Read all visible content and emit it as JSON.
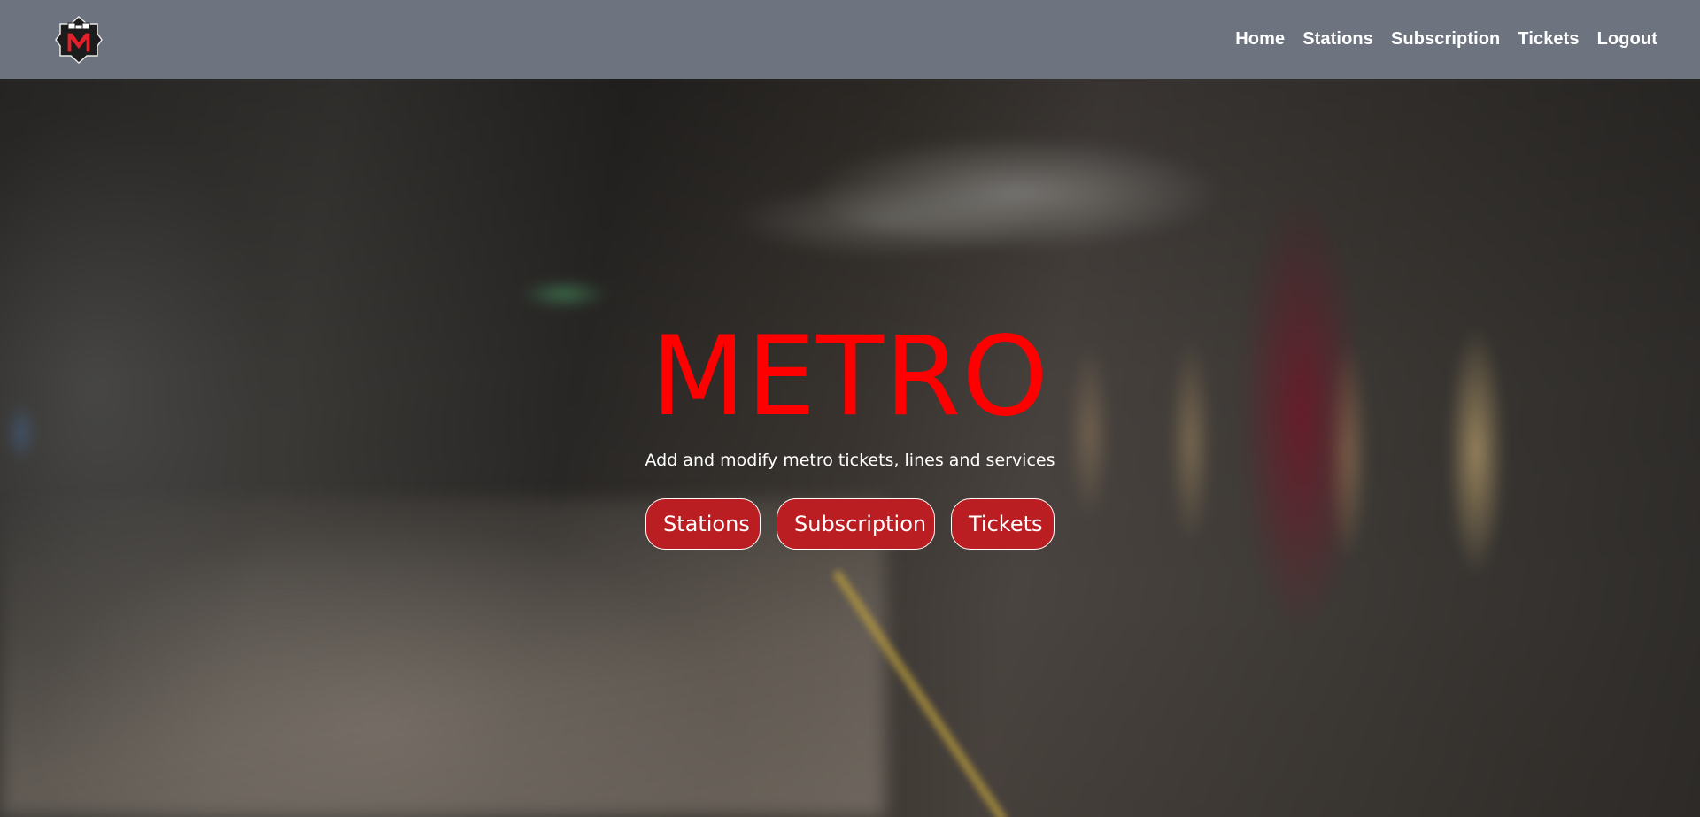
{
  "header": {
    "logo_icon": "metro-m-logo-icon",
    "nav": [
      {
        "label": "Home"
      },
      {
        "label": "Stations"
      },
      {
        "label": "Subscription"
      },
      {
        "label": "Tickets"
      },
      {
        "label": "Logout"
      }
    ]
  },
  "hero": {
    "title": "METRO",
    "subtitle": "Add and modify metro tickets, lines and services",
    "buttons": [
      {
        "label": "Stations"
      },
      {
        "label": "Subscription"
      },
      {
        "label": "Tickets"
      }
    ],
    "title_color": "#ff0000",
    "button_color": "#bb1e22"
  },
  "colors": {
    "navbar": "#6d7480"
  }
}
